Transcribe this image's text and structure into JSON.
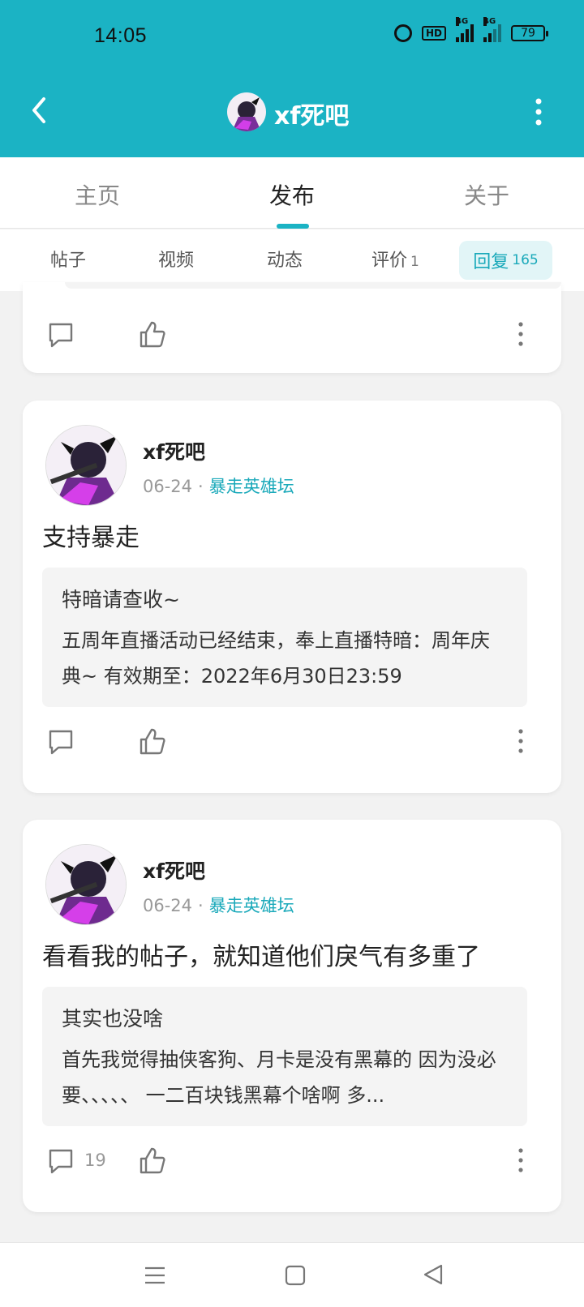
{
  "status": {
    "time": "14:05",
    "hd": "HD",
    "net1": "4G",
    "net2": "4G",
    "battery": "79"
  },
  "header": {
    "title": "xf死吧"
  },
  "tabs": [
    {
      "label": "主页",
      "active": false
    },
    {
      "label": "发布",
      "active": true
    },
    {
      "label": "关于",
      "active": false
    }
  ],
  "subtabs": {
    "posts": "帖子",
    "videos": "视频",
    "moments": "动态",
    "reviews": "评价",
    "reviews_count": "1",
    "replies": "回复",
    "replies_count": "165"
  },
  "cards": [
    {
      "username": "xf死吧",
      "date": "06-24",
      "forum": "暴走英雄坛",
      "content": "支持暴走",
      "quote_title": "特暗请查收~",
      "quote_body": "五周年直播活动已经结束，奉上直播特暗：周年庆典~ 有效期至：2022年6月30日23:59",
      "comment_count": ""
    },
    {
      "username": "xf死吧",
      "date": "06-24",
      "forum": "暴走英雄坛",
      "content": "看看我的帖子，就知道他们戾气有多重了",
      "quote_title": "其实也没啥",
      "quote_body": "首先我觉得抽侠客狗、月卡是没有黑幕的 因为没必要、、、、、 一二百块钱黑幕个啥啊 多...",
      "comment_count": "19"
    }
  ],
  "colors": {
    "accent": "#1bb3c4",
    "accent_text": "#1aa9ba",
    "page_bg": "#f2f2f2"
  },
  "icons": [
    "back-icon",
    "more-icon",
    "comment-icon",
    "like-icon",
    "more-vertical-icon",
    "menu-icon",
    "home-icon",
    "nav-back-icon"
  ]
}
